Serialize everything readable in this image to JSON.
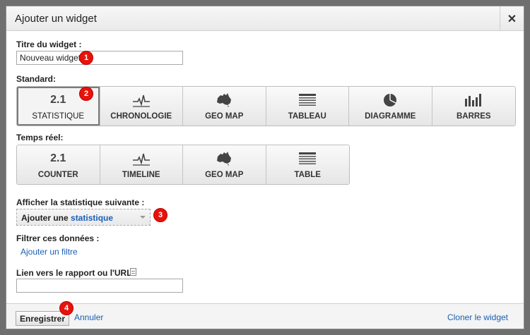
{
  "dialog": {
    "title": "Ajouter un widget",
    "close_label": "✕"
  },
  "widget_title": {
    "label": "Titre du widget :",
    "value": "Nouveau widget"
  },
  "standard": {
    "label": "Standard:",
    "buttons": [
      {
        "label": "STATISTIQUE",
        "icon": "stat-number-icon",
        "icon_text": "2.1",
        "selected": true
      },
      {
        "label": "CHRONOLOGIE",
        "icon": "timeline-icon"
      },
      {
        "label": "GEO MAP",
        "icon": "australia-map-icon"
      },
      {
        "label": "TABLEAU",
        "icon": "table-icon"
      },
      {
        "label": "DIAGRAMME",
        "icon": "pie-chart-icon"
      },
      {
        "label": "BARRES",
        "icon": "bar-chart-icon"
      }
    ]
  },
  "realtime": {
    "label": "Temps réel:",
    "buttons": [
      {
        "label": "COUNTER",
        "icon": "stat-number-icon",
        "icon_text": "2.1"
      },
      {
        "label": "TIMELINE",
        "icon": "timeline-icon"
      },
      {
        "label": "GEO MAP",
        "icon": "australia-map-icon"
      },
      {
        "label": "TABLE",
        "icon": "table-icon"
      }
    ]
  },
  "metric": {
    "label": "Afficher la statistique suivante :",
    "select_prefix": "Ajouter une",
    "select_accent": "statistique"
  },
  "filter": {
    "label": "Filtrer ces données :",
    "link": "Ajouter un filtre"
  },
  "report_link": {
    "label": "Lien vers le rapport ou l'URL :",
    "value": ""
  },
  "footer": {
    "save_label": "Enregistrer",
    "cancel_label": "Annuler",
    "clone_label": "Cloner le widget"
  },
  "badges": [
    "1",
    "2",
    "3",
    "4"
  ],
  "colors": {
    "badge": "#e8120c",
    "link": "#1a5fb4",
    "backdrop": "#6f6f6f"
  }
}
